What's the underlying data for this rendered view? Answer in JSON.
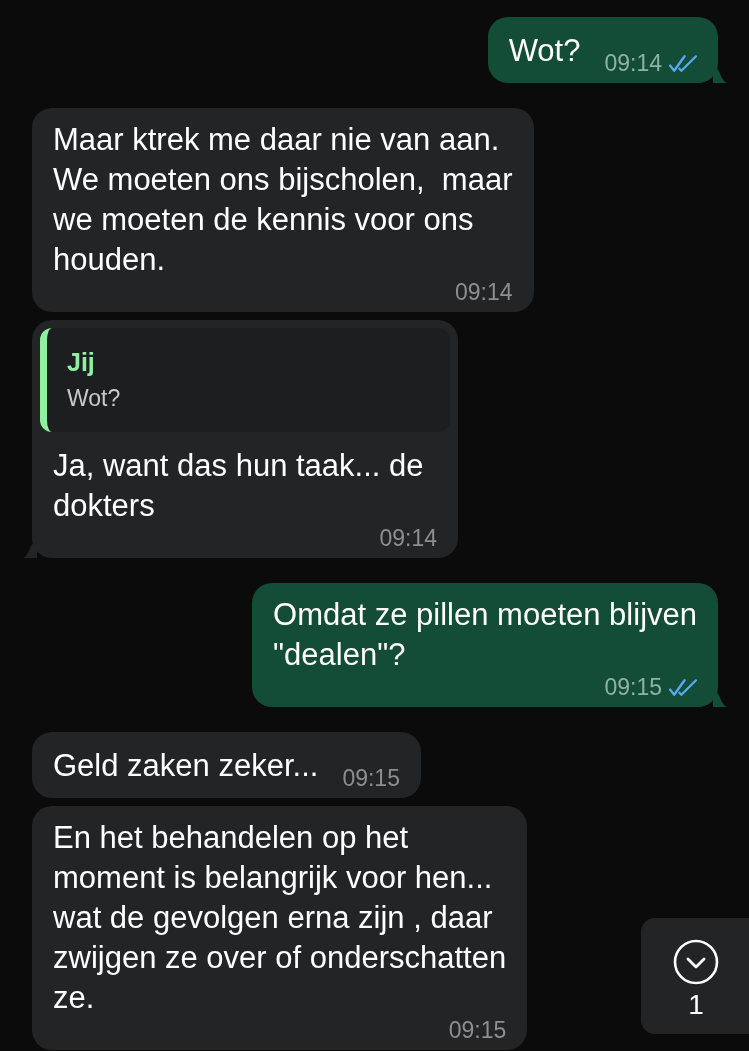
{
  "messages": [
    {
      "outgoing": true,
      "tail": true,
      "lines": [
        "Wot?"
      ],
      "time": "09:14",
      "read": true
    },
    {
      "outgoing": false,
      "tail": false,
      "lines": [
        "Maar ktrek me daar nie van aan.",
        "We moeten ons bijscholen,  maar",
        "we moeten de kennis voor ons",
        "houden."
      ],
      "time": "09:14"
    },
    {
      "outgoing": false,
      "tail": true,
      "quote": {
        "author": "Jij",
        "text": "Wot?"
      },
      "lines": [
        "Ja, want das hun taak... de",
        "dokters"
      ],
      "time": "09:14"
    },
    {
      "outgoing": true,
      "tail": true,
      "lines": [
        "Omdat ze pillen moeten blijven",
        "\"dealen\"?"
      ],
      "time": "09:15",
      "read": true
    },
    {
      "outgoing": false,
      "tail": false,
      "lines": [
        "Geld zaken zeker..."
      ],
      "time": "09:15"
    },
    {
      "outgoing": false,
      "tail": false,
      "lines": [
        "En het behandelen op het",
        "moment is belangrijk voor hen...",
        "wat de gevolgen erna zijn , daar",
        "zwijgen ze over of onderschatten",
        "ze."
      ],
      "time": "09:15"
    }
  ],
  "scroll_button": {
    "count": "1"
  }
}
